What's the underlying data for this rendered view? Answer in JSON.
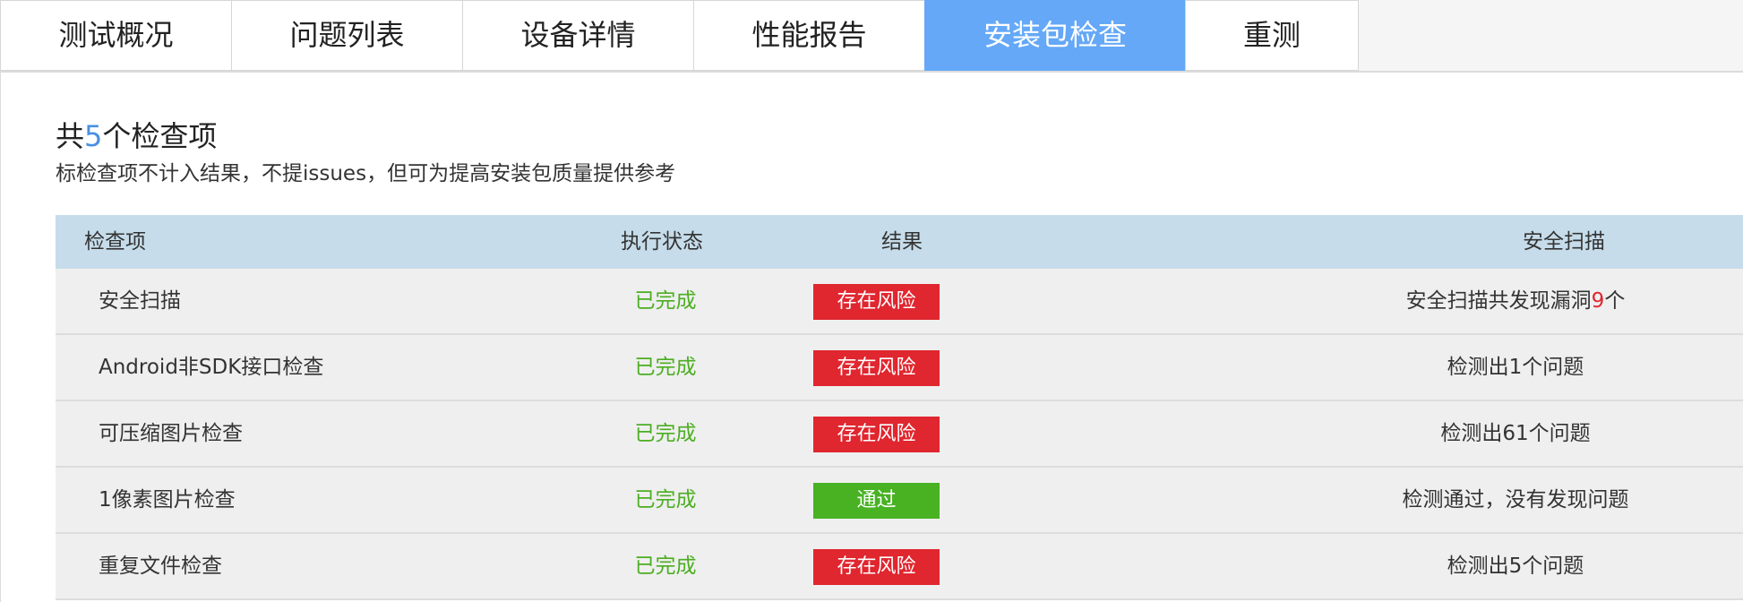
{
  "tabs": [
    {
      "label": "测试概况"
    },
    {
      "label": "问题列表"
    },
    {
      "label": "设备详情"
    },
    {
      "label": "性能报告"
    },
    {
      "label": "安装包检查"
    },
    {
      "label": "重测"
    }
  ],
  "active_tab": "安装包检查",
  "summary": {
    "prefix": "共",
    "count": "5",
    "suffix": "个检查项"
  },
  "note": "标检查项不计入结果，不提issues，但可为提高安装包质量提供参考",
  "table": {
    "headers": {
      "name": "检查项",
      "status": "执行状态",
      "result": "结果",
      "desc": "安全扫描"
    },
    "rows": [
      {
        "name": "安全扫描",
        "status": "已完成",
        "result": "存在风险",
        "desc_prefix": "安全扫描共发现漏洞",
        "desc_highlight": "9",
        "desc_suffix": "个"
      },
      {
        "name": "Android非SDK接口检查",
        "status": "已完成",
        "result": "存在风险",
        "desc": "检测出1个问题"
      },
      {
        "name": "可压缩图片检查",
        "status": "已完成",
        "result": "存在风险",
        "desc": "检测出61个问题"
      },
      {
        "name": "1像素图片检查",
        "status": "已完成",
        "result": "通过",
        "desc": "检测通过，没有发现问题"
      },
      {
        "name": "重复文件检查",
        "status": "已完成",
        "result": "存在风险",
        "desc": "检测出5个问题"
      }
    ]
  },
  "colors": {
    "tab_active": "#64a8f7",
    "header_bg": "#c6dcea",
    "status_done": "#4cae22",
    "risk": "#e0262f",
    "pass": "#48b223",
    "count": "#4a90e2"
  }
}
